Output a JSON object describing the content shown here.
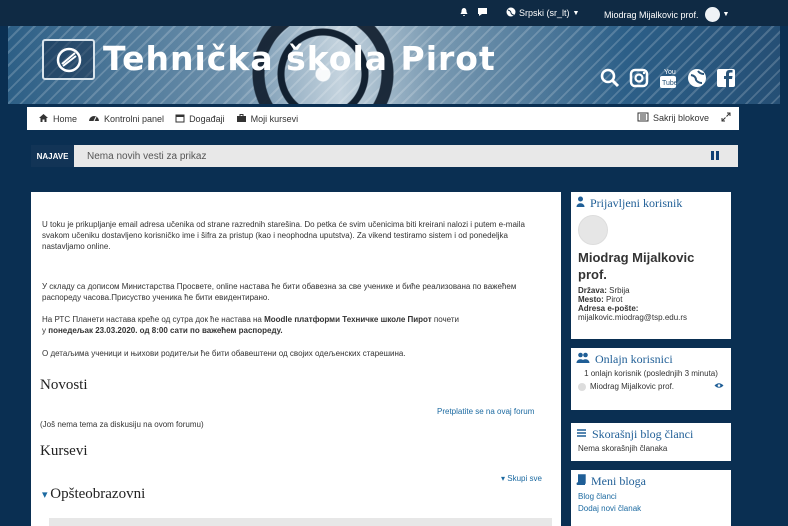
{
  "topbar": {
    "language": "Srpski (sr_lt)",
    "user": "Miodrag Mijalkovic prof.",
    "icons": [
      "bell-icon",
      "chat-icon",
      "globe-icon",
      "avatar"
    ]
  },
  "banner": {
    "title": "Tehnička škola Pirot",
    "icons": [
      "search-icon",
      "instagram-icon",
      "youtube-icon",
      "globe-icon",
      "facebook-icon"
    ]
  },
  "nav": {
    "items": [
      "Home",
      "Kontrolni panel",
      "Događaji",
      "Moji kursevi"
    ],
    "hide_blocks": "Sakrij blokove"
  },
  "news": {
    "label": "NAJAVE",
    "message": "Nema novih vesti za prikaz"
  },
  "main": {
    "paragraphs": [
      "U toku je prikupljanje email adresa učenika od strane razrednih starešina. Do petka će svim učenicima biti kreirani nalozi i putem e-maila svakom učeniku dostavljeno korisničko ime i šifra za pristup (kao i neophodna uputstva). Za vikend testiramo sistem i od ponedeljka nastavljamo online.",
      "У складу са дописом Министарства Просвете, online настава ће бити обавезна за све ученике и биће реализована по важећем распореду часова.Присуство ученика ће бити евидентирано.",
      "На РТС Планети настава креће од сутра док ће настава на Moodle платформи Техничке школе Пирот почети у понедељак 23.03.2020. од 8:00 сати по важећем распореду.",
      "О детаљима ученици и њихови родитељи ће бити обавештени од својих одељенских старешина."
    ],
    "rts_a": "На РТС Планети настава креће од сутра док ће настава на ",
    "rts_b": "Moodle платформи Техничке школе Пирот",
    "rts_c": " почети",
    "rts_d": "у ",
    "rts_e": "понедељак 23.03.2020. од 8:00 сати по важећем распореду.",
    "news_heading": "Novosti",
    "subscribe": "Pretplatite se na ovaj forum",
    "no_topics": "(Još nema tema za diskusiju na ovom forumu)",
    "courses_heading": "Kursevi",
    "collapse_all": "Skupi sve",
    "category": "Opšteobrazovni"
  },
  "sidebar": {
    "logged_in": {
      "title": "Prijavljeni korisnik",
      "name": "Miodrag Mijalkovic prof.",
      "country_label": "Država:",
      "country": "Srbija",
      "place_label": "Mesto:",
      "place": "Pirot",
      "email_label": "Adresa e-pošte:",
      "email": "mijalkovic.miodrag@tsp.edu.rs"
    },
    "online": {
      "title": "Onlajn korisnici",
      "summary": "1 onlajn korisnik (poslednjih 3 minuta)",
      "user": "Miodrag Mijalkovic prof."
    },
    "blog_recent": {
      "title": "Skorašnji blog članci",
      "empty": "Nema skorašnjih članaka"
    },
    "blog_menu": {
      "title": "Meni bloga",
      "items": [
        "Blog članci",
        "Dodaj novi članak"
      ]
    }
  },
  "colors": {
    "accent": "#1f5e96",
    "topbar": "#0f2a44",
    "news_label": "#123456"
  }
}
